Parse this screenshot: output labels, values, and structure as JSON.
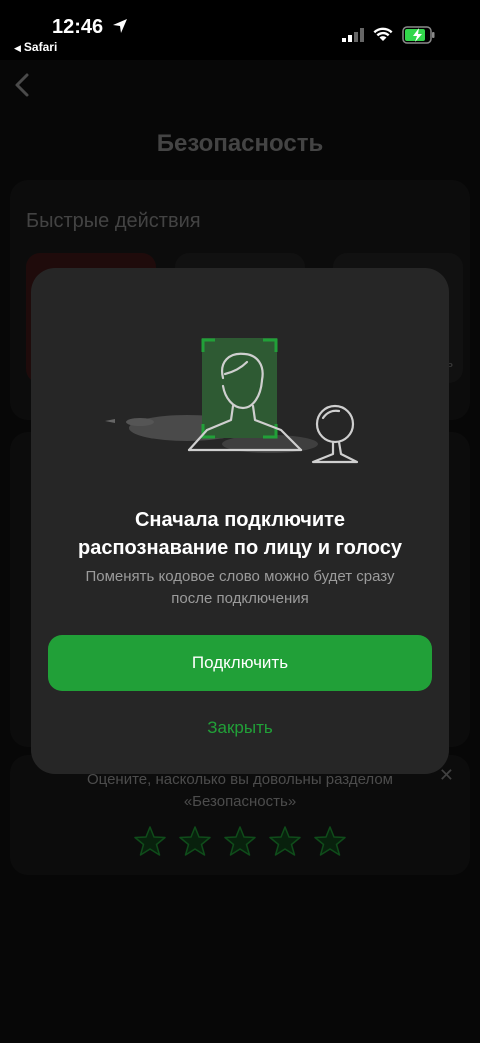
{
  "status_bar": {
    "time": "12:46",
    "back_app": "Safari",
    "accent": "#21a038"
  },
  "page": {
    "title": "Безопасность",
    "quick_actions": {
      "title": "Быстрые действия",
      "tile_fragment": "ь"
    },
    "rating": {
      "text_line1": "Оцените, насколько вы довольны разделом",
      "text_line2": "«Безопасность»",
      "stars": 5
    }
  },
  "modal": {
    "title_line1": "Сначала подключите",
    "title_line2": "распознавание по лицу и голосу",
    "subtitle_line1": "Поменять кодовое слово можно будет сразу",
    "subtitle_line2": "после подключения",
    "primary_button": "Подключить",
    "secondary_button": "Закрыть"
  }
}
